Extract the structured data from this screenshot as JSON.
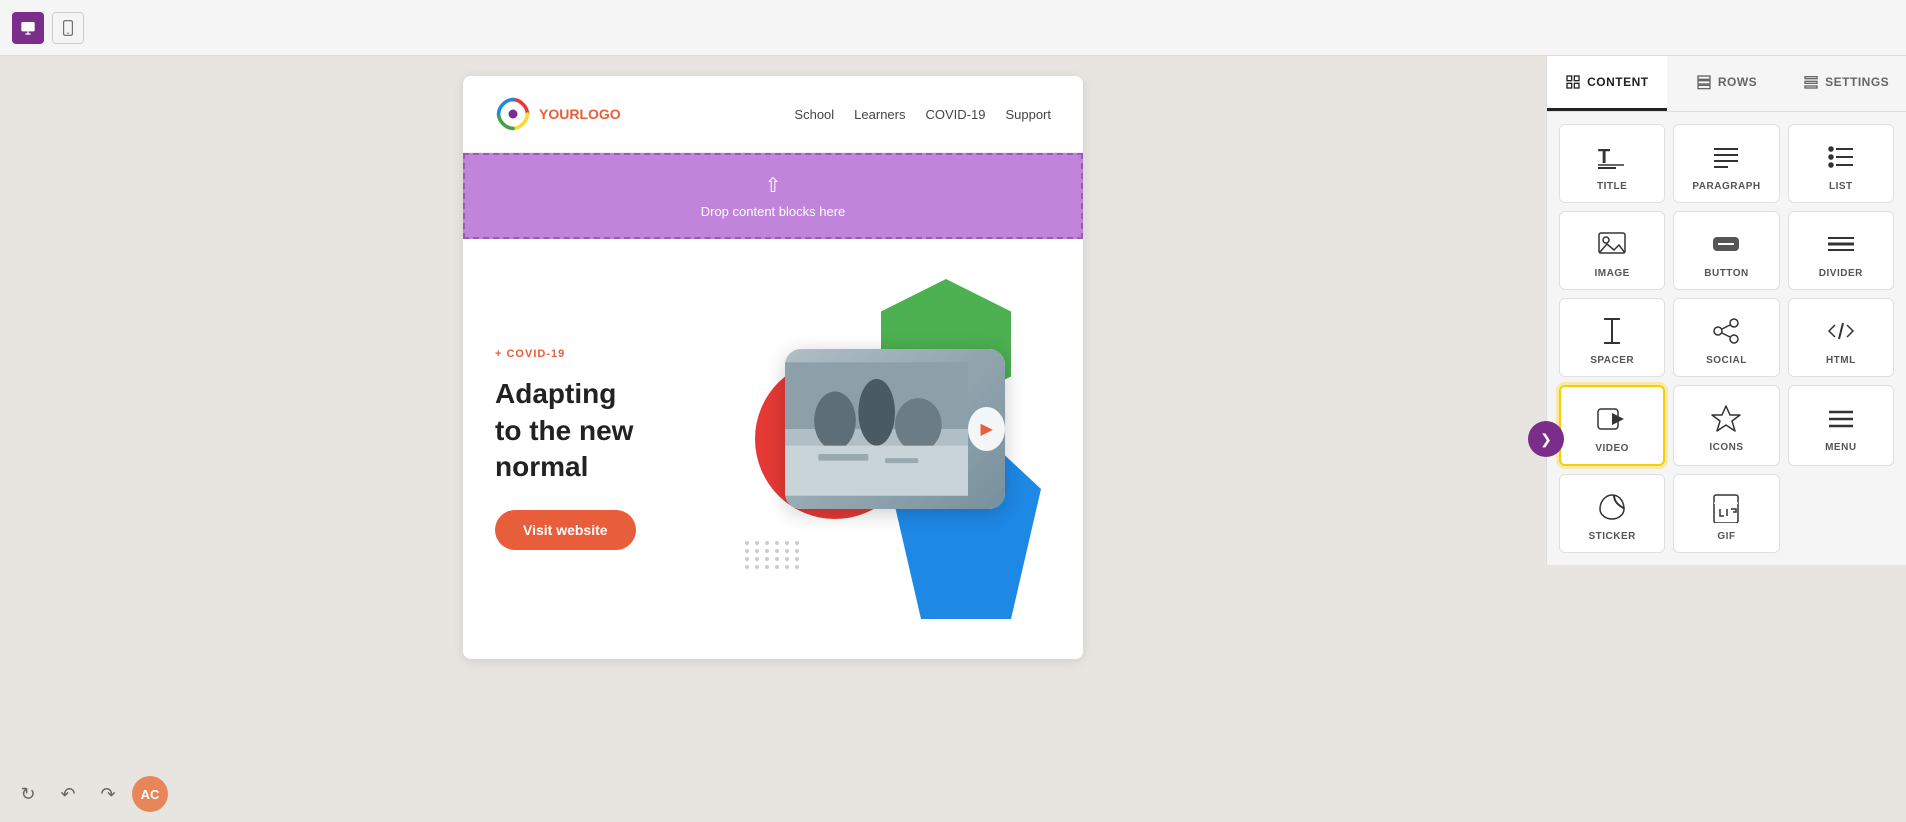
{
  "toolbar": {
    "desktop_label": "Desktop view",
    "mobile_label": "Mobile view",
    "undo_label": "Undo",
    "redo_label": "Redo",
    "user_initials": "AC"
  },
  "panel": {
    "tabs": [
      {
        "id": "content",
        "label": "CONTENT",
        "active": true
      },
      {
        "id": "rows",
        "label": "ROWS",
        "active": false
      },
      {
        "id": "settings",
        "label": "SETTINGS",
        "active": false
      }
    ],
    "content_blocks": [
      {
        "id": "title",
        "label": "TITLE"
      },
      {
        "id": "paragraph",
        "label": "PARAGRAPH"
      },
      {
        "id": "list",
        "label": "LIST"
      },
      {
        "id": "image",
        "label": "IMAGE"
      },
      {
        "id": "button",
        "label": "BUTTON"
      },
      {
        "id": "divider",
        "label": "DIVIDER"
      },
      {
        "id": "spacer",
        "label": "SPACER"
      },
      {
        "id": "social",
        "label": "SOCIAL"
      },
      {
        "id": "html",
        "label": "HTML"
      },
      {
        "id": "video",
        "label": "VIDEO",
        "highlighted": true
      },
      {
        "id": "icons",
        "label": "ICONS"
      },
      {
        "id": "menu",
        "label": "MENU"
      },
      {
        "id": "sticker",
        "label": "STICKER"
      },
      {
        "id": "gif",
        "label": "GIF"
      }
    ]
  },
  "email": {
    "logo_text_your": "YOUR",
    "logo_text_logo": "LOGO",
    "nav": [
      {
        "label": "School"
      },
      {
        "label": "Learners"
      },
      {
        "label": "COVID-19"
      },
      {
        "label": "Support"
      }
    ],
    "drop_zone_text": "Drop content blocks here",
    "hero_tag": "+ COVID-19",
    "hero_title": "Adapting\nto the new\nnormal",
    "hero_btn_label": "Visit website"
  }
}
